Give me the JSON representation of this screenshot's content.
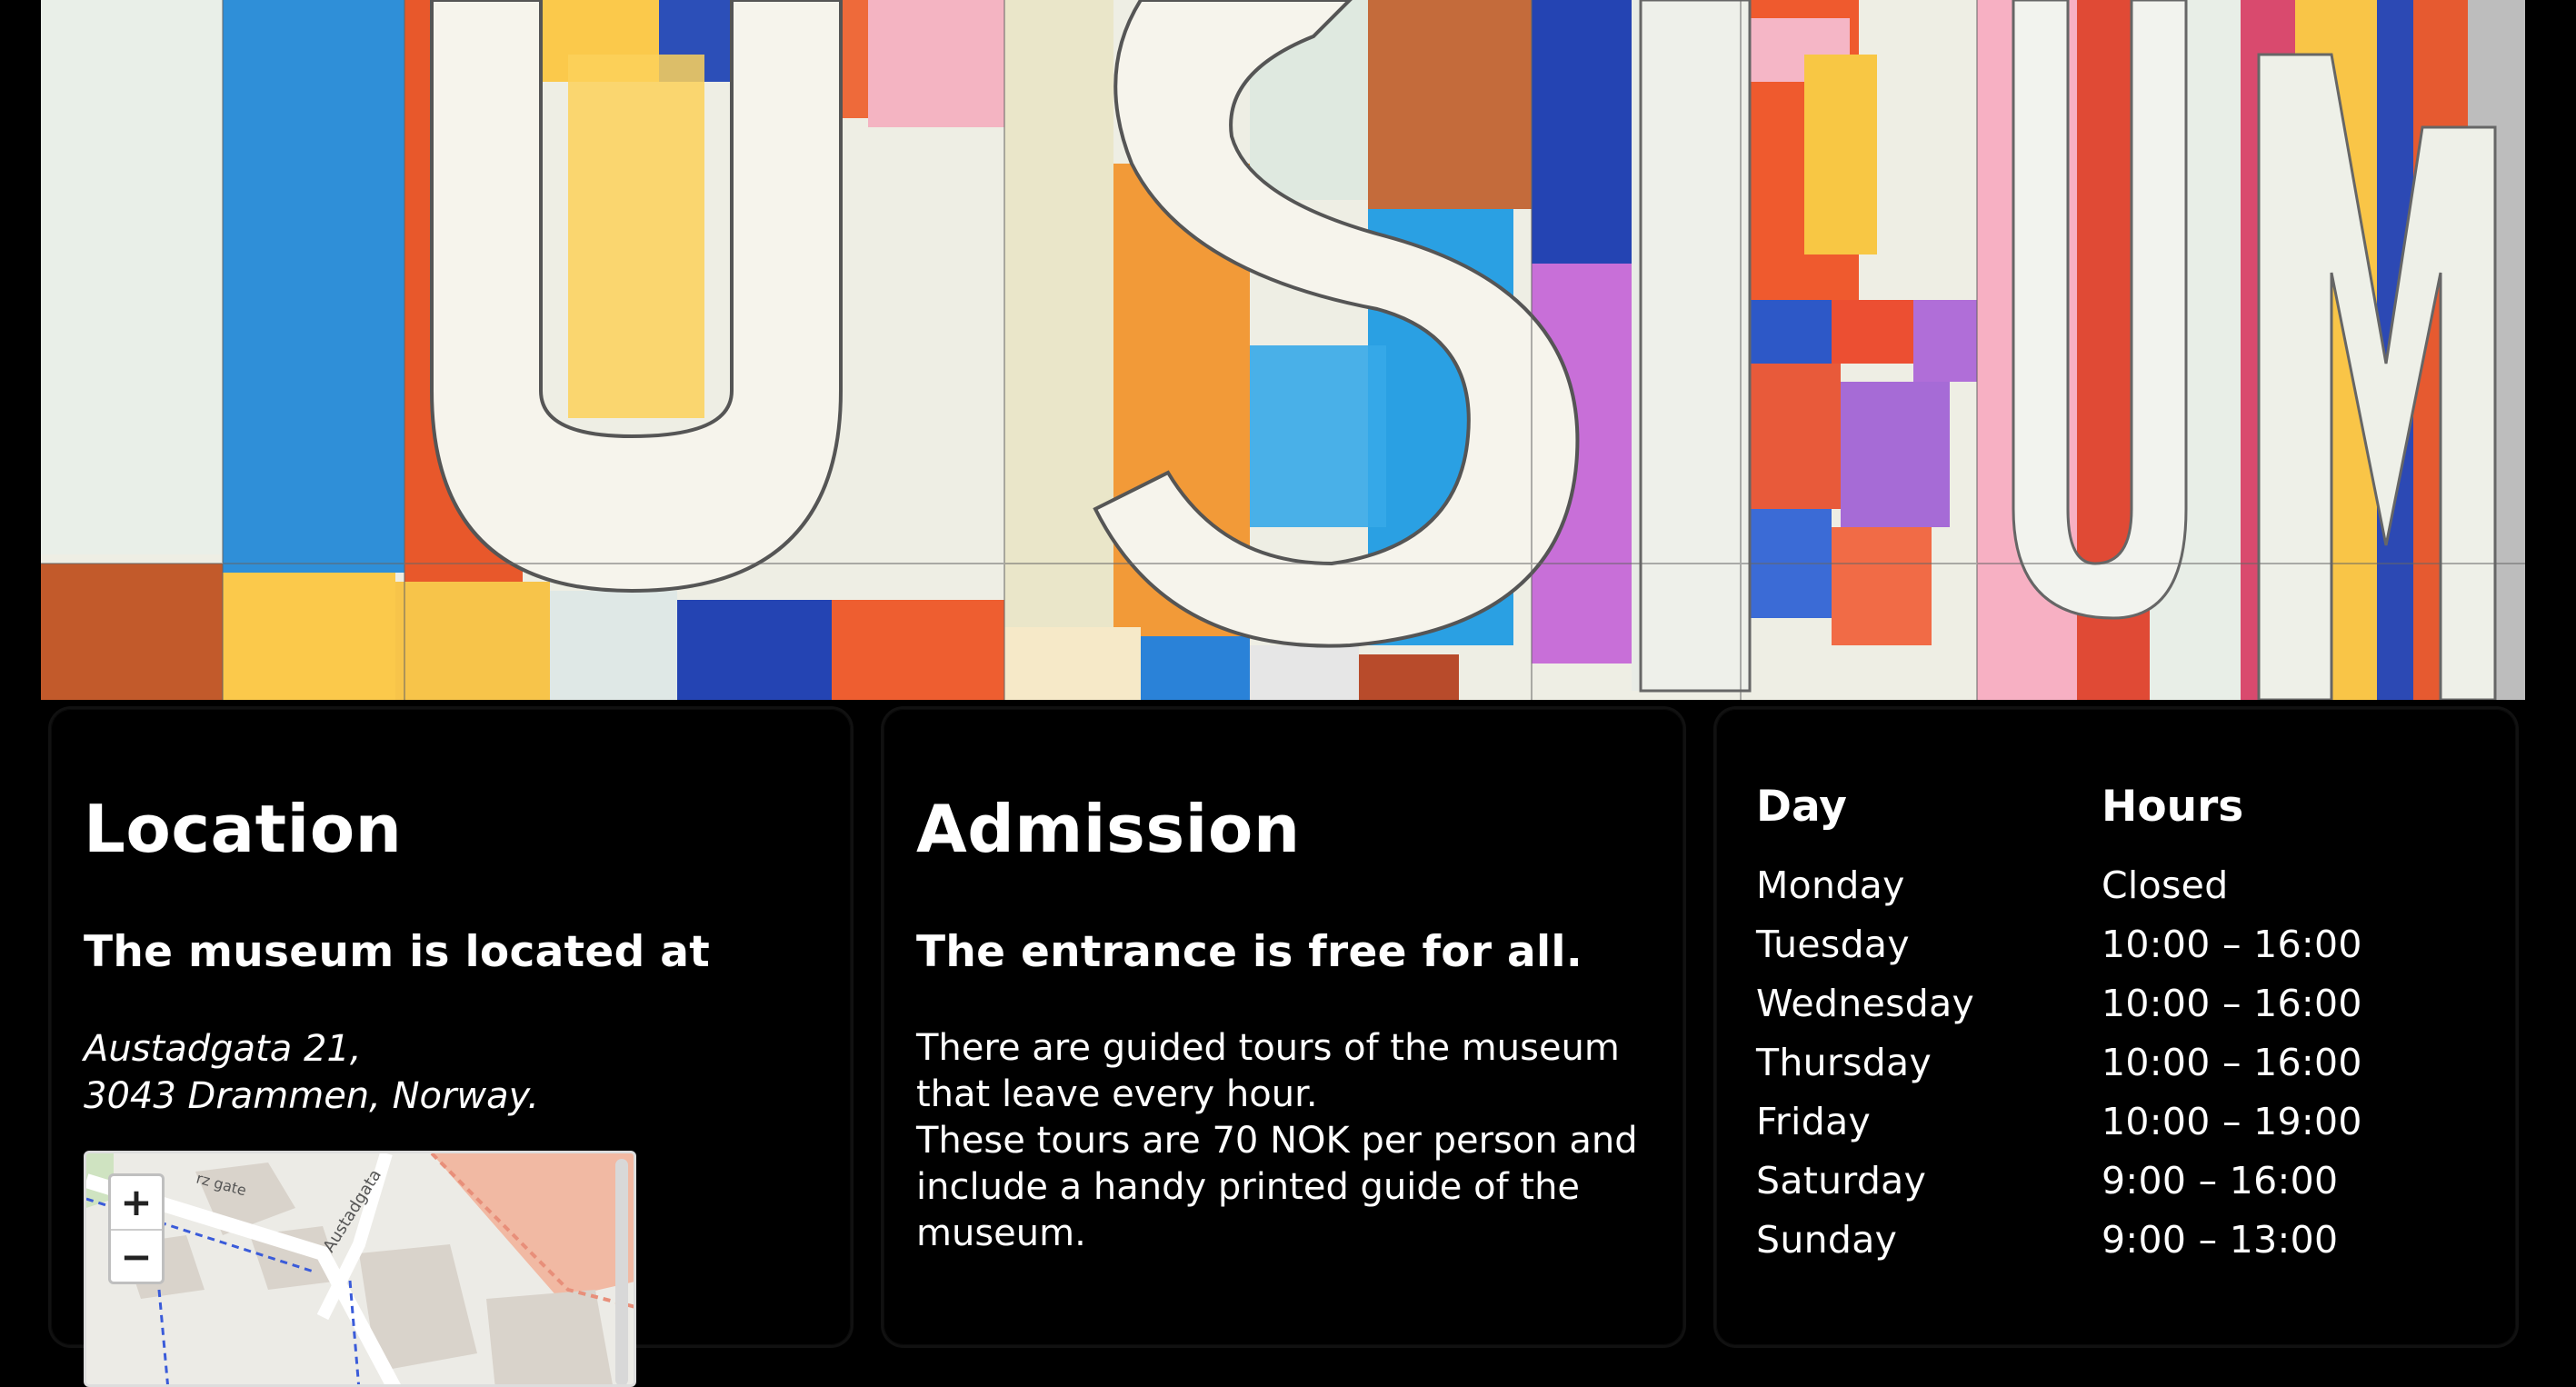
{
  "hero": {
    "image_alt": "Colorful museum facade with large letters",
    "lettering": "USEUM"
  },
  "location": {
    "title": "Location",
    "lead": "The museum is located at",
    "address_line1": "Austadgata 21,",
    "address_line2": "3043 Drammen, Norway.",
    "map": {
      "zoom_in_label": "+",
      "zoom_out_label": "−",
      "street_label_1": "Austadgata",
      "street_label_2": "rz gate"
    }
  },
  "admission": {
    "title": "Admission",
    "lead": "The entrance is free for all.",
    "body_line1": "There are guided tours of the museum that leave every hour.",
    "body_line2": "These tours are 70 NOK per person and include a handy printed guide of the museum."
  },
  "hours": {
    "header_day": "Day",
    "header_hours": "Hours",
    "rows": [
      {
        "day": "Monday",
        "hours": "Closed"
      },
      {
        "day": "Tuesday",
        "hours": "10:00 – 16:00"
      },
      {
        "day": "Wednesday",
        "hours": "10:00 – 16:00"
      },
      {
        "day": "Thursday",
        "hours": "10:00 – 16:00"
      },
      {
        "day": "Friday",
        "hours": "10:00 – 19:00"
      },
      {
        "day": "Saturday",
        "hours": "9:00 – 16:00"
      },
      {
        "day": "Sunday",
        "hours": "9:00 – 13:00"
      }
    ]
  },
  "colors": {
    "background": "#000000",
    "text": "#ffffff",
    "card_border": "#111111",
    "map_road_orange": "#f1b9a3",
    "map_path_blue": "#3a5bd9"
  }
}
